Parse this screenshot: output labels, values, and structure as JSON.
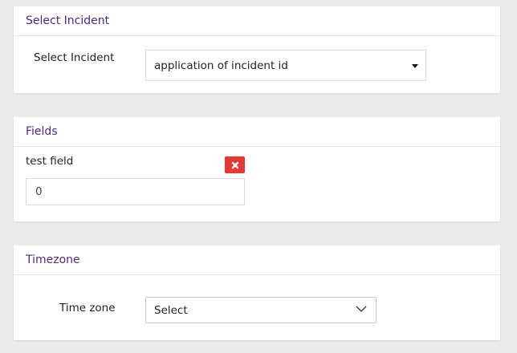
{
  "select_incident_panel": {
    "title": "Select Incident",
    "label": "Select Incident",
    "selected_value": "application of incident id"
  },
  "fields_panel": {
    "title": "Fields",
    "fields": [
      {
        "label": "test field",
        "value": "0"
      }
    ]
  },
  "timezone_panel": {
    "title": "Timezone",
    "label": "Time zone",
    "selected_value": "Select"
  },
  "colors": {
    "header_text": "#4b2a88",
    "delete_button": "#e53935",
    "background": "#ebebeb"
  },
  "icons": {
    "incident_dropdown": "caret-down-icon",
    "delete_field": "close-icon",
    "timezone_dropdown": "chevron-down-icon"
  }
}
